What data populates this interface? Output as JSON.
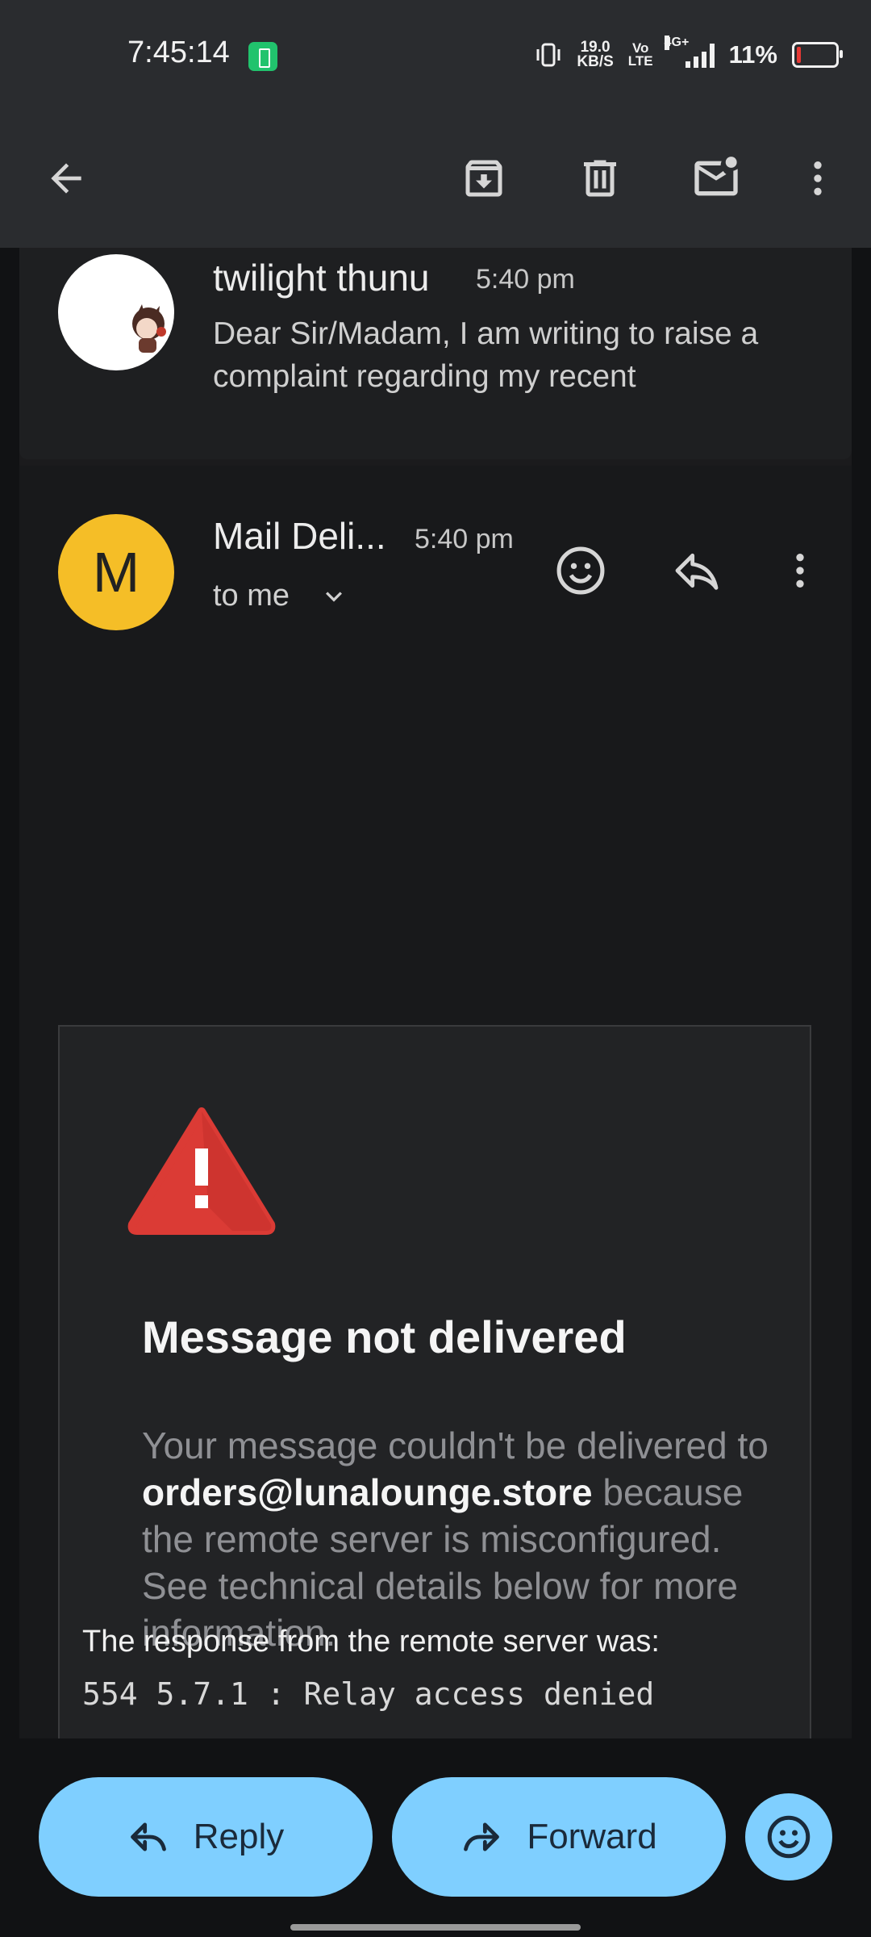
{
  "status_bar": {
    "time": "7:45:14",
    "net_speed_value": "19.0",
    "net_speed_unit": "KB/S",
    "volte_top": "Vo",
    "volte_bottom": "LTE",
    "network": "4G+",
    "battery_percent": "11%",
    "battery_level": 0.11,
    "icons": [
      "battery-saver-icon",
      "vibrate-icon",
      "signal-icon",
      "battery-icon"
    ]
  },
  "toolbar": {
    "icons": [
      "back-arrow-icon",
      "archive-icon",
      "delete-icon",
      "mark-unread-icon",
      "more-vert-icon"
    ]
  },
  "thread": {
    "collapsed_message": {
      "sender": "twilight thunu",
      "time": "5:40 pm",
      "snippet": "Dear Sir/Madam, I am writing to raise a complaint regarding my recent"
    },
    "open_message": {
      "avatar_letter": "M",
      "avatar_color": "#f5be27",
      "sender": "Mail Deli...",
      "time": "5:40 pm",
      "recipient": "to me",
      "bounce": {
        "title": "Message not delivered",
        "body_before": "Your message couldn't be delivered to ",
        "email": "orders@lunalounge.store",
        "body_after": " because the remote server is misconfigured. See technical details below for more information."
      },
      "response_label": "The response from the remote server was:",
      "response_code": "554 5.7.1 : Relay access denied"
    }
  },
  "bottom_actions": {
    "reply_label": "Reply",
    "forward_label": "Forward",
    "accent_color": "#7fcfff"
  }
}
